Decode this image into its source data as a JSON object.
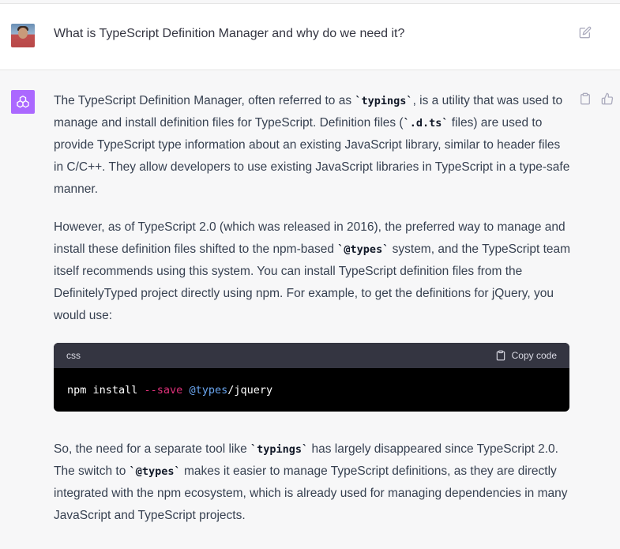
{
  "user_message": {
    "avatar_icon": "user-avatar-photo",
    "text": "What is TypeScript Definition Manager and why do we need it?",
    "edit_icon": "edit-icon"
  },
  "assistant_message": {
    "avatar_icon": "chatgpt-logo-icon",
    "avatar_color": "#ab68ff",
    "actions": [
      "clipboard-icon",
      "thumbs-up-icon"
    ],
    "p1": {
      "t1": "The TypeScript Definition Manager, often referred to as ",
      "c1": "`typings`",
      "t2": ", is a utility that was used to manage and install definition files for TypeScript. Definition files (",
      "c2": "`.d.ts`",
      "t3": " files) are used to provide TypeScript type information about an existing JavaScript library, similar to header files in C/C++. They allow developers to use existing JavaScript libraries in TypeScript in a type-safe manner."
    },
    "p2": {
      "t1": "However, as of TypeScript 2.0 (which was released in 2016), the preferred way to manage and install these definition files shifted to the npm-based ",
      "c1": "`@types`",
      "t2": " system, and the TypeScript team itself recommends using this system. You can install TypeScript definition files from the DefinitelyTyped project directly using npm. For example, to get the definitions for jQuery, you would use:"
    },
    "code_block": {
      "language": "css",
      "copy_label": "Copy code",
      "tokens": {
        "cmd": "npm install ",
        "flag": "--save",
        "space": " ",
        "at": "@types",
        "rest": "/jquery"
      }
    },
    "p3": {
      "t1": "So, the need for a separate tool like ",
      "c1": "`typings`",
      "t2": " has largely disappeared since TypeScript 2.0. The switch to ",
      "c2": "`@types`",
      "t3": " makes it easier to manage TypeScript definitions, as they are directly integrated with the npm ecosystem, which is already used for managing dependencies in many JavaScript and TypeScript projects."
    }
  }
}
